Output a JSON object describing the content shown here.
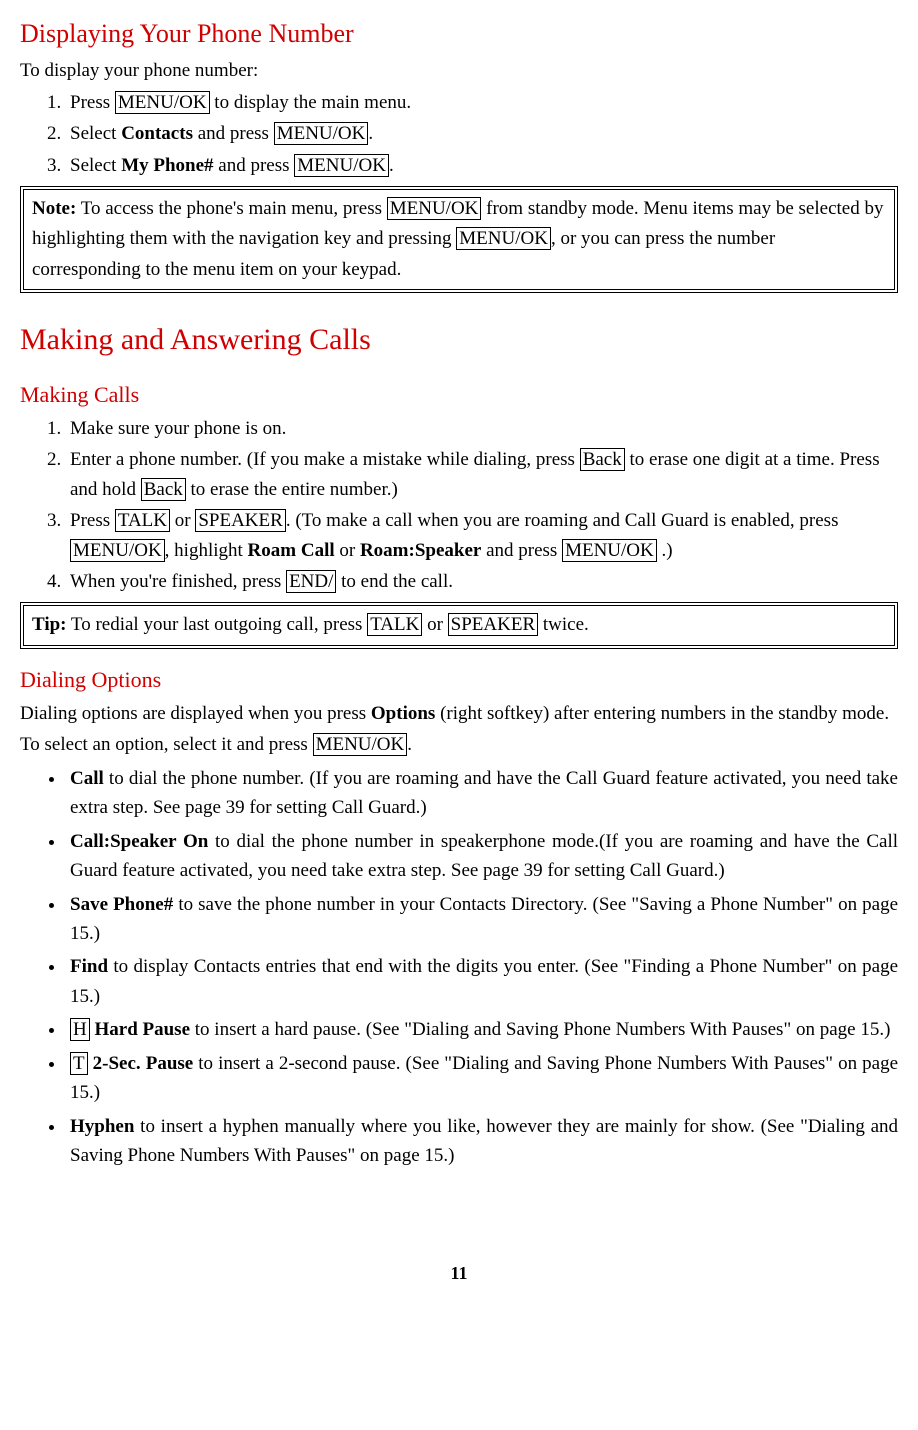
{
  "page_number": "11",
  "keys": {
    "menu_ok": "MENU/OK",
    "back": "Back",
    "talk": "TALK",
    "speaker": "SPEAKER",
    "end": "END/",
    "H": "H",
    "T": "T"
  },
  "bold": {
    "contacts": "Contacts",
    "my_phone": "My Phone#",
    "note": "Note:",
    "tip": "Tip:",
    "roam_call": "Roam Call",
    "roam_speaker": "Roam:Speaker",
    "options": "Options",
    "call": "Call",
    "call_speaker_on": "Call:Speaker On",
    "save_phone": "Save Phone#",
    "find": "Find",
    "hard_pause": "Hard Pause",
    "two_sec_pause": "2-Sec. Pause",
    "hyphen": "Hyphen"
  },
  "section1": {
    "heading": "Displaying Your Phone Number",
    "intro": "To display your phone number:",
    "step1_a": "Press ",
    "step1_b": " to display the main menu.",
    "step2_a": "Select ",
    "step2_b": " and press ",
    "step2_c": ".",
    "step3_a": "Select ",
    "step3_b": " and press ",
    "step3_c": "."
  },
  "note_box": {
    "a": " To access the phone's main menu, press ",
    "b": " from standby mode. Menu items may be selected by highlighting them with the navigation key and pressing ",
    "c": ", or you can press the number corresponding to the menu item on your keypad."
  },
  "section2": {
    "heading": "Making and Answering Calls",
    "sub1": "Making Calls",
    "s1": "Make sure your phone is on.",
    "s2_a": "Enter a phone number. (If you make a mistake while dialing, press ",
    "s2_b": " to erase one digit at a time. Press and hold ",
    "s2_c": " to erase the entire number.)",
    "s3_a": "Press ",
    "s3_b": " or ",
    "s3_c": ". (To make a call when you are roaming and Call Guard is enabled, press ",
    "s3_d": ", highlight ",
    "s3_e": " or ",
    "s3_f": " and press ",
    "s3_g": " .)",
    "s4_a": "When you're finished, press ",
    "s4_b": " to end the call."
  },
  "tip_box": {
    "a": " To redial your last outgoing call, press ",
    "b": " or ",
    "c": " twice."
  },
  "section3": {
    "heading": "Dialing Options",
    "intro_a": "Dialing options are displayed when you press ",
    "intro_b": " (right softkey) after entering numbers in the standby mode.",
    "intro2_a": "To select an option, select it and press ",
    "intro2_b": ".",
    "b1": " to dial the phone number. (If you are roaming and have the Call Guard feature activated, you need take extra step. See page 39 for setting Call Guard.)",
    "b2": " to dial the phone number in speakerphone mode.(If you are roaming and have the Call Guard feature activated, you need take extra step. See page 39 for setting Call Guard.)",
    "b3": " to save the phone number in your Contacts Directory. (See \"Saving a Phone Number\" on page 15.)",
    "b4": " to display Contacts entries that end with the digits you enter. (See \"Finding a Phone Number\" on page 15.)",
    "b5_a": " ",
    "b5_b": " to insert a hard pause. (See \"Dialing and Saving Phone Numbers With Pauses\" on page 15.)",
    "b6_a": " ",
    "b6_b": " to insert a 2-second pause. (See \"Dialing and Saving Phone Numbers With Pauses\" on page 15.)",
    "b7": " to insert a hyphen manually where you like, however they are mainly for show. (See \"Dialing and Saving Phone Numbers With Pauses\" on page 15.)"
  }
}
